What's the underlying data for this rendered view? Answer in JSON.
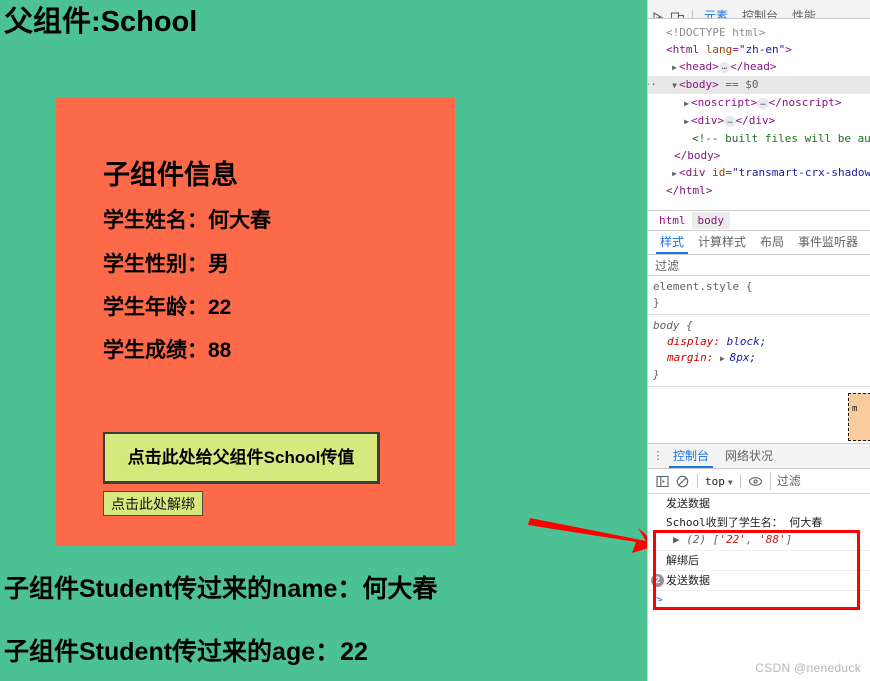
{
  "page": {
    "title": "父组件:School",
    "background_color": "#4cc294",
    "child": {
      "background_color": "#fc6a4a",
      "heading": "子组件信息",
      "fields": [
        {
          "label": "学生姓名：",
          "value": "何大春"
        },
        {
          "label": "学生性别：",
          "value": "男"
        },
        {
          "label": "学生年龄：",
          "value": "22"
        },
        {
          "label": "学生成绩：",
          "value": "88"
        }
      ],
      "emit_button_label": "点击此处给父组件School传值",
      "unbind_button_label": "点击此处解绑",
      "button_color": "#d6e97f"
    },
    "received": [
      "子组件Student传过来的name：何大春",
      "子组件Student传过来的age：22"
    ]
  },
  "devtools": {
    "main_tabs": [
      {
        "label": "元素",
        "selected": true
      },
      {
        "label": "控制台",
        "selected": false
      },
      {
        "label": "性能",
        "selected": false
      }
    ],
    "dom_tree": [
      {
        "indent": 0,
        "twisty": "none",
        "text": "<!DOCTYPE html>",
        "kind": "doctype"
      },
      {
        "indent": 0,
        "twisty": "none",
        "text": "<html lang=\"zh-en\">",
        "kind": "tag-attr"
      },
      {
        "indent": 1,
        "twisty": "closed",
        "text": "<head>…</head>",
        "kind": "tag-ellipsis"
      },
      {
        "indent": 1,
        "twisty": "open",
        "text": "<body> == $0",
        "kind": "tag-selected",
        "selected": true
      },
      {
        "indent": 2,
        "twisty": "closed",
        "text": "<noscript>…</noscript>",
        "kind": "tag-ellipsis"
      },
      {
        "indent": 2,
        "twisty": "closed",
        "text": "<div>…</div>",
        "kind": "tag-ellipsis"
      },
      {
        "indent": 3,
        "twisty": "none",
        "text": "<!-- built files will be au",
        "kind": "comment"
      },
      {
        "indent": 1,
        "twisty": "none",
        "text": "</body>",
        "kind": "tag"
      },
      {
        "indent": 1,
        "twisty": "closed",
        "text": "<div id=\"transmart-crx-shadow",
        "kind": "tag-attr"
      },
      {
        "indent": 0,
        "twisty": "none",
        "text": "</html>",
        "kind": "tag"
      }
    ],
    "breadcrumb": [
      {
        "label": "html",
        "selected": false
      },
      {
        "label": "body",
        "selected": true
      }
    ],
    "style_tabs": [
      {
        "label": "样式",
        "selected": true
      },
      {
        "label": "计算样式",
        "selected": false
      },
      {
        "label": "布局",
        "selected": false
      },
      {
        "label": "事件监听器",
        "selected": false
      }
    ],
    "style_filter_placeholder": "过滤",
    "css_rules": [
      {
        "selector": "element.style {",
        "close": "}",
        "declarations": []
      },
      {
        "selector": "body {",
        "close": "}",
        "declarations": [
          {
            "name": "display",
            "value": "block;",
            "expandable": false
          },
          {
            "name": "margin",
            "value": "8px;",
            "expandable": true
          }
        ]
      }
    ],
    "box_model_label": "m",
    "drawer": {
      "tabs": [
        {
          "label": "控制台",
          "selected": true
        },
        {
          "label": "网络状况",
          "selected": false
        }
      ],
      "toolbar": {
        "sidebar_toggle": "sidebar-icon",
        "clear": "clear-icon",
        "context": "top",
        "eye": "eye-icon",
        "filter_placeholder": "过滤"
      },
      "messages": [
        {
          "text": "发送数据",
          "count": null,
          "expandable": false
        },
        {
          "text": "School收到了学生名： 何大春",
          "count": null,
          "expandable": false,
          "grouped": true
        },
        {
          "text": "(2) ['22', '88']",
          "count": null,
          "expandable": true,
          "is_array": true,
          "array_count": "(2)",
          "array_items": [
            "'22'",
            "'88'"
          ]
        },
        {
          "text": "解绑后",
          "count": null,
          "expandable": false
        },
        {
          "text": "发送数据",
          "count": "2",
          "expandable": false
        }
      ],
      "prompt": ">"
    }
  },
  "annotation": {
    "arrow_color": "#ff0000",
    "highlight_color": "#ff0000"
  },
  "watermark": "CSDN @neneduck"
}
